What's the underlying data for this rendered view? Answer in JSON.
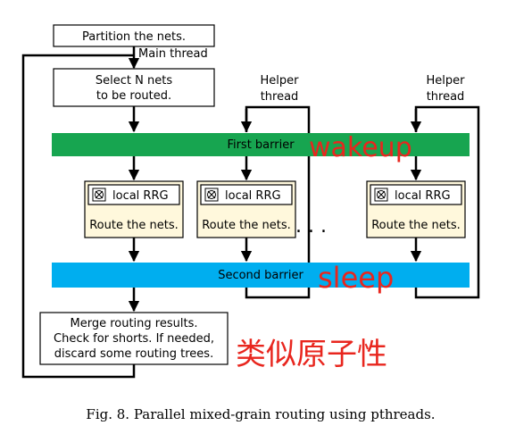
{
  "diagram": {
    "partition_box": "Partition the nets.",
    "main_thread_label": "Main thread",
    "select_box": [
      "Select N nets",
      "to be routed."
    ],
    "helper_thread_label_1": [
      "Helper",
      "thread"
    ],
    "helper_thread_label_2": [
      "Helper",
      "thread"
    ],
    "first_barrier": "First barrier",
    "wakeup_annotation": "wakeup",
    "local_rrg_label": "local RRG",
    "route_nets_label": "Route the nets.",
    "ellipsis": ". . .",
    "second_barrier": "Second barrier",
    "sleep_annotation": "sleep",
    "merge_box": [
      "Merge routing results.",
      "Check for shorts. If needed,",
      "discard some routing trees."
    ],
    "atomicity_annotation": "类似原子性",
    "caption": "Fig. 8.  Parallel mixed-grain routing using pthreads."
  },
  "colors": {
    "first_barrier_bg": "#17a550",
    "second_barrier_bg": "#00aeef",
    "annotation_red": "#e8261e",
    "worker_box_bg": "#fff8dc"
  }
}
